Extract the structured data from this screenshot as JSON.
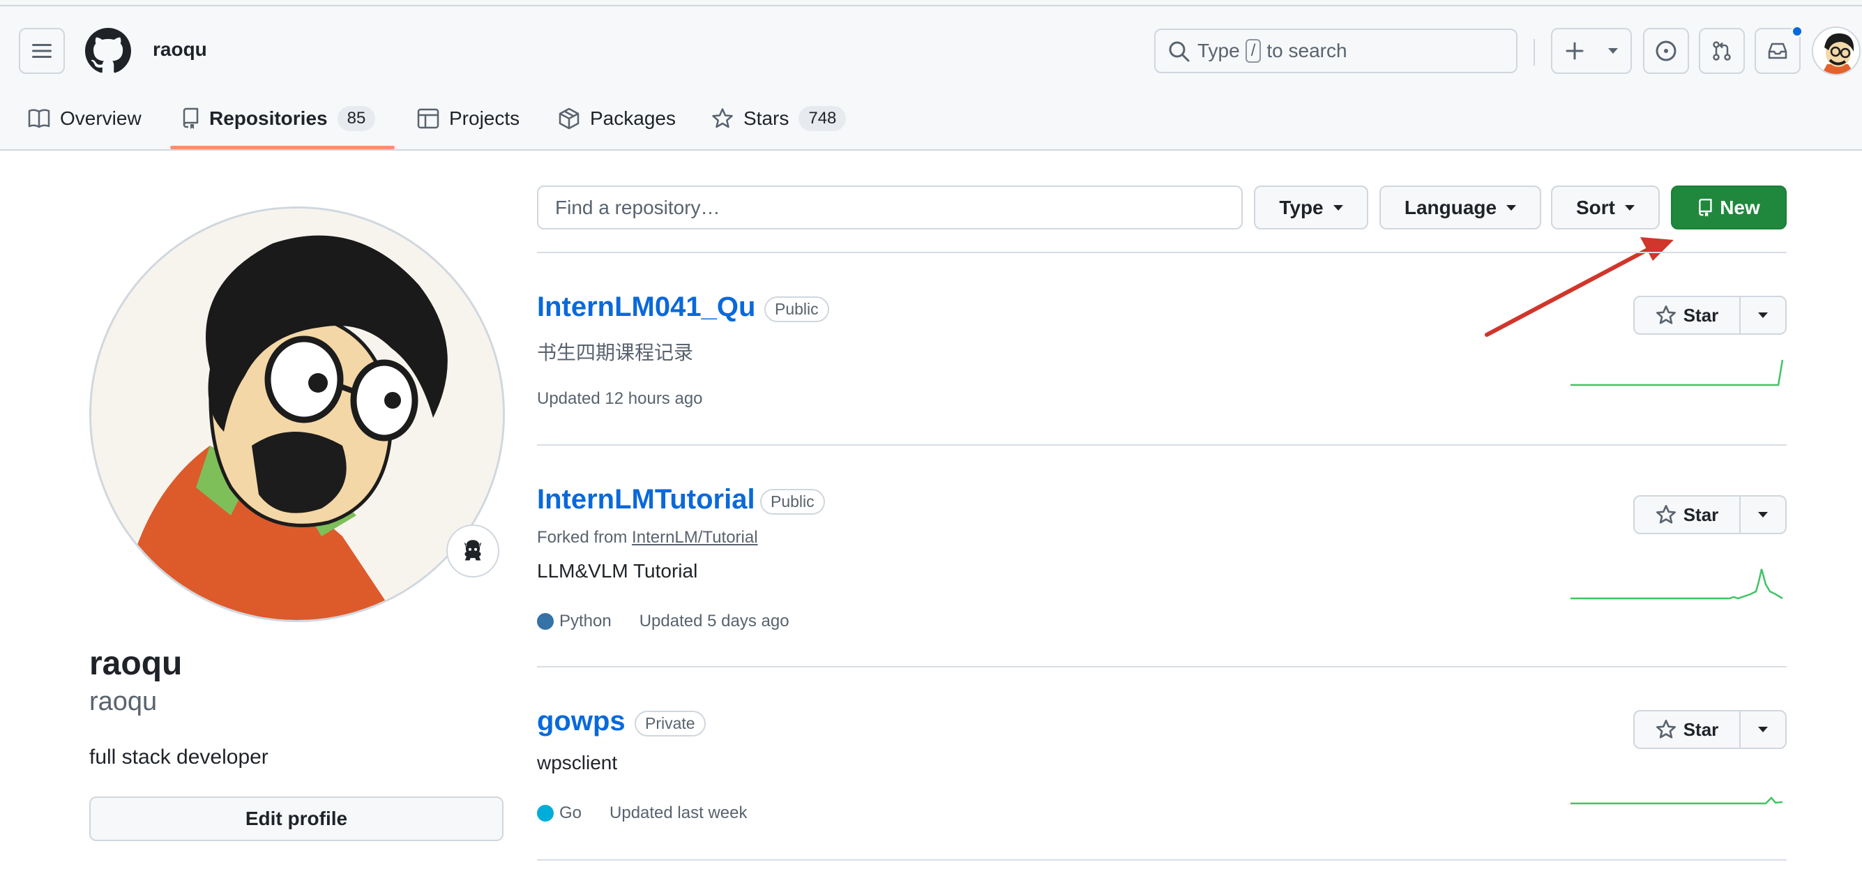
{
  "header": {
    "username": "raoqu",
    "search": {
      "prefix": "Type",
      "key": "/",
      "suffix": "to search"
    }
  },
  "tabs": [
    {
      "label": "Overview"
    },
    {
      "label": "Repositories",
      "count": "85",
      "selected": true
    },
    {
      "label": "Projects"
    },
    {
      "label": "Packages"
    },
    {
      "label": "Stars",
      "count": "748"
    }
  ],
  "profile": {
    "name": "raoqu",
    "login": "raoqu",
    "bio": "full stack developer",
    "edit_label": "Edit profile"
  },
  "filters": {
    "find_placeholder": "Find a repository…",
    "type_label": "Type",
    "language_label": "Language",
    "sort_label": "Sort",
    "new_label": "New"
  },
  "repos": [
    {
      "name": "InternLM041_Qu",
      "visibility": "Public",
      "description": "书生四期课程记录",
      "updated": "Updated 12 hours ago",
      "star_label": "Star"
    },
    {
      "name": "InternLMTutorial",
      "visibility": "Public",
      "forked_prefix": "Forked from",
      "forked_from": "InternLM/Tutorial",
      "description": "LLM&VLM Tutorial",
      "language": "Python",
      "language_color": "#3572A5",
      "updated": "Updated 5 days ago",
      "star_label": "Star"
    },
    {
      "name": "gowps",
      "visibility": "Private",
      "description": "wpsclient",
      "language": "Go",
      "language_color": "#00ADD8",
      "updated": "Updated last week",
      "star_label": "Star"
    }
  ],
  "colors": {
    "accent": "#0969da",
    "new_button": "#1f883d",
    "tab_underline": "#fd8c73",
    "annotation_arrow": "#d0362b"
  }
}
